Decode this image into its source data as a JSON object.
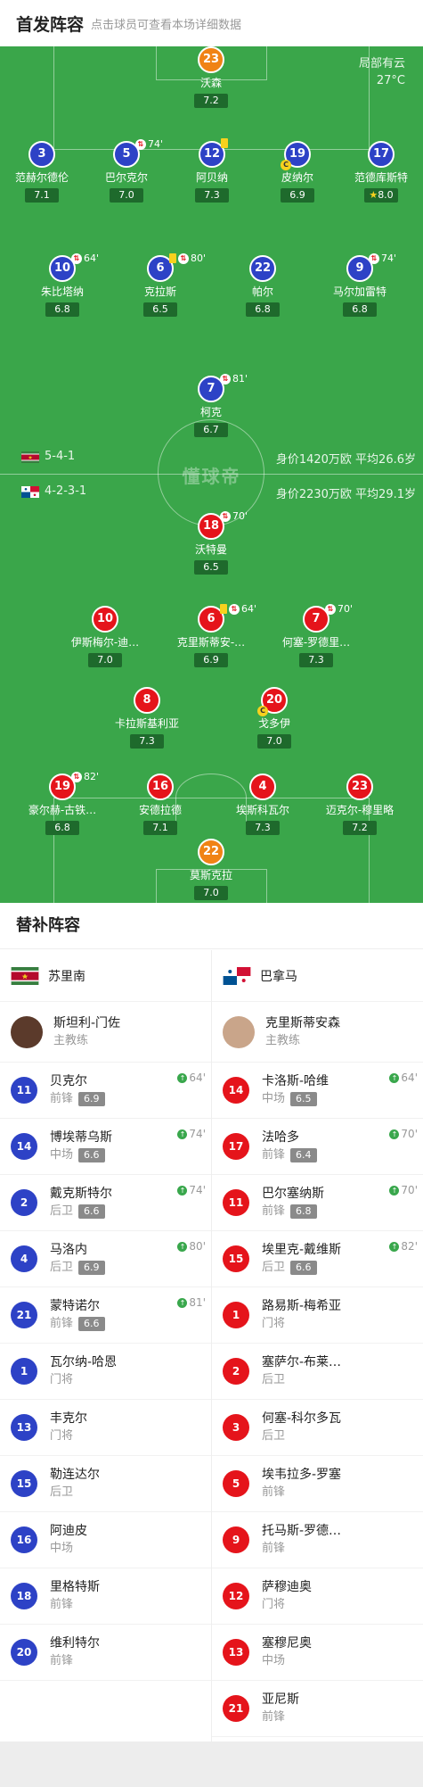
{
  "header": {
    "title": "首发阵容",
    "subtitle": "点击球员可查看本场详细数据"
  },
  "weather": {
    "condition": "局部有云",
    "temperature": "27°C"
  },
  "watermark": "懂球帝",
  "colors": {
    "pitch": "#3aa64a",
    "home": "#2d42c6",
    "away": "#e5141b",
    "goalkeeper": "#f08315",
    "card": "#f7d11e"
  },
  "home_team": {
    "name": "苏里南",
    "formation": "5-4-1",
    "value": "身价1420万欧 平均26.6岁",
    "coach_name": "斯坦利-门佐",
    "coach_role": "主教练",
    "lineup": [
      {
        "number": "23",
        "name": "沃森",
        "rating": "7.2",
        "gk": true
      },
      {
        "number": "3",
        "name": "范赫尔德伦",
        "rating": "7.1"
      },
      {
        "number": "5",
        "name": "巴尔克尔",
        "rating": "7.0",
        "sub_minute": "74'"
      },
      {
        "number": "12",
        "name": "阿贝纳",
        "rating": "7.3",
        "yellow": true
      },
      {
        "number": "19",
        "name": "皮纳尔",
        "rating": "6.9",
        "captain": "C"
      },
      {
        "number": "17",
        "name": "范德库斯特",
        "rating": "8.0",
        "star": true
      },
      {
        "number": "10",
        "name": "朱比塔纳",
        "rating": "6.8",
        "sub_minute": "64'"
      },
      {
        "number": "6",
        "name": "克拉斯",
        "rating": "6.5",
        "yellow": true,
        "sub_minute": "80'"
      },
      {
        "number": "22",
        "name": "帕尔",
        "rating": "6.8"
      },
      {
        "number": "9",
        "name": "马尔加雷特",
        "rating": "6.8",
        "sub_minute": "74'"
      },
      {
        "number": "7",
        "name": "柯克",
        "rating": "6.7",
        "sub_minute": "81'"
      }
    ],
    "subs": [
      {
        "number": "11",
        "name": "贝克尔",
        "position": "前锋",
        "rating": "6.9",
        "in": "64'"
      },
      {
        "number": "14",
        "name": "博埃蒂乌斯",
        "position": "中场",
        "rating": "6.6",
        "in": "74'"
      },
      {
        "number": "2",
        "name": "戴克斯特尔",
        "position": "后卫",
        "rating": "6.6",
        "in": "74'"
      },
      {
        "number": "4",
        "name": "马洛内",
        "position": "后卫",
        "rating": "6.9",
        "in": "80'"
      },
      {
        "number": "21",
        "name": "蒙特诺尔",
        "position": "前锋",
        "rating": "6.6",
        "in": "81'"
      },
      {
        "number": "1",
        "name": "瓦尔纳-哈恩",
        "position": "门将"
      },
      {
        "number": "13",
        "name": "丰克尔",
        "position": "门将"
      },
      {
        "number": "15",
        "name": "勒连达尔",
        "position": "后卫"
      },
      {
        "number": "16",
        "name": "阿迪皮",
        "position": "中场"
      },
      {
        "number": "18",
        "name": "里格特斯",
        "position": "前锋"
      },
      {
        "number": "20",
        "name": "维利特尔",
        "position": "前锋"
      }
    ]
  },
  "away_team": {
    "name": "巴拿马",
    "formation": "4-2-3-1",
    "value": "身价2230万欧 平均29.1岁",
    "coach_name": "克里斯蒂安森",
    "coach_role": "主教练",
    "lineup": [
      {
        "number": "18",
        "name": "沃特曼",
        "rating": "6.5",
        "sub_minute": "70'"
      },
      {
        "number": "10",
        "name": "伊斯梅尔-迪…",
        "rating": "7.0"
      },
      {
        "number": "6",
        "name": "克里斯蒂安-…",
        "rating": "6.9",
        "yellow": true,
        "sub_minute": "64'"
      },
      {
        "number": "7",
        "name": "何塞-罗德里…",
        "rating": "7.3",
        "sub_minute": "70'"
      },
      {
        "number": "8",
        "name": "卡拉斯基利亚",
        "rating": "7.3"
      },
      {
        "number": "20",
        "name": "戈多伊",
        "rating": "7.0",
        "captain": "C"
      },
      {
        "number": "19",
        "name": "豪尔赫-古铁…",
        "rating": "6.8",
        "sub_minute": "82'"
      },
      {
        "number": "16",
        "name": "安德拉德",
        "rating": "7.1"
      },
      {
        "number": "4",
        "name": "埃斯科瓦尔",
        "rating": "7.3"
      },
      {
        "number": "23",
        "name": "迈克尔-穆里略",
        "rating": "7.2"
      },
      {
        "number": "22",
        "name": "莫斯克拉",
        "rating": "7.0",
        "gk": true
      }
    ],
    "subs": [
      {
        "number": "14",
        "name": "卡洛斯-哈维",
        "position": "中场",
        "rating": "6.5",
        "in": "64'"
      },
      {
        "number": "17",
        "name": "法哈多",
        "position": "前锋",
        "rating": "6.4",
        "in": "70'"
      },
      {
        "number": "11",
        "name": "巴尔塞纳斯",
        "position": "前锋",
        "rating": "6.8",
        "in": "70'"
      },
      {
        "number": "15",
        "name": "埃里克-戴维斯",
        "position": "后卫",
        "rating": "6.6",
        "in": "82'"
      },
      {
        "number": "1",
        "name": "路易斯-梅希亚",
        "position": "门将"
      },
      {
        "number": "2",
        "name": "塞萨尔-布莱…",
        "position": "后卫"
      },
      {
        "number": "3",
        "name": "何塞-科尔多瓦",
        "position": "后卫"
      },
      {
        "number": "5",
        "name": "埃韦拉多-罗塞",
        "position": "前锋"
      },
      {
        "number": "9",
        "name": "托马斯-罗德…",
        "position": "前锋"
      },
      {
        "number": "12",
        "name": "萨穆迪奥",
        "position": "门将"
      },
      {
        "number": "13",
        "name": "塞穆尼奥",
        "position": "中场"
      },
      {
        "number": "21",
        "name": "亚尼斯",
        "position": "前锋"
      }
    ]
  },
  "subs_title": "替补阵容"
}
